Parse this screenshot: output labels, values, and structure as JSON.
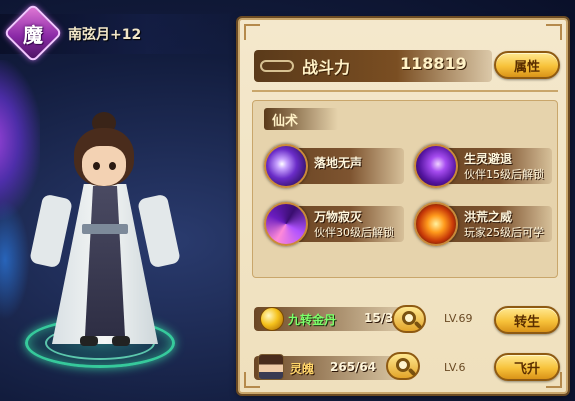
{
  "character": {
    "class_char": "魔",
    "name": "南弦月+12"
  },
  "panel": {
    "power_label": "战斗力",
    "power_value": "118819",
    "attributes_button": "属性",
    "spell_tab": "仙术",
    "skills": [
      {
        "name": "落地无声",
        "note": "",
        "icon": "purple-slash-icon"
      },
      {
        "name": "生灵避退",
        "note": "伙伴15级后解锁",
        "icon": "purple-vortex-icon"
      },
      {
        "name": "万物寂灭",
        "note": "伙伴30级后解锁",
        "icon": "galaxy-swirl-icon"
      },
      {
        "name": "洪荒之威",
        "note": "玩家25级后可学",
        "icon": "fire-ring-icon"
      }
    ],
    "items": [
      {
        "name": "九转金丹",
        "count": "15/35",
        "level": "LV.69",
        "button": "转生",
        "icon": "gold-pill-icon"
      },
      {
        "name": "灵魄",
        "count": "265/64",
        "level": "LV.6",
        "button": "飞升",
        "icon": "pet-portrait-icon"
      }
    ]
  },
  "colors": {
    "panel_bg": "#f4e8cc",
    "button_gold": "#f7c23a",
    "item_green": "#7cff6a"
  }
}
